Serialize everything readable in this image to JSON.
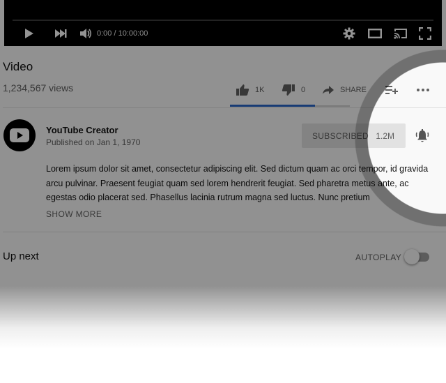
{
  "player": {
    "time_display": "0:00 / 10:00:00"
  },
  "video": {
    "title": "Video",
    "views": "1,234,567 views",
    "actions": {
      "like_count": "1K",
      "dislike_count": "0",
      "share_label": "SHARE"
    }
  },
  "channel": {
    "name": "YouTube Creator",
    "published": "Published on Jan 1, 1970",
    "subscribe_label": "SUBSCRIBED",
    "subscriber_count": "1.2M"
  },
  "description": {
    "text": "Lorem ipsum dolor sit amet, consectetur adipiscing elit. Sed dictum quam ac orci tempor, id gravida arcu pulvinar. Praesent feugiat quam sed lorem hendrerit feugiat. Sed pharetra metus ante, ac egestas odio placerat sed. Phasellus lacinia rutrum magna sed luctus. Nunc pretium",
    "show_more_label": "SHOW MORE"
  },
  "up_next": {
    "title": "Up next",
    "autoplay_label": "AUTOPLAY",
    "autoplay_on": false
  },
  "icons": {
    "play": "play-icon",
    "next": "skip-next-icon",
    "volume": "volume-icon",
    "settings": "gear-icon",
    "theater": "theater-mode-icon",
    "cast": "cast-icon",
    "fullscreen": "fullscreen-icon",
    "like": "thumbs-up-icon",
    "dislike": "thumbs-down-icon",
    "share": "share-arrow-icon",
    "add_to": "add-to-playlist-icon",
    "more": "more-dots-icon",
    "bell": "bell-icon"
  },
  "colors": {
    "accent_blue": "#2a65c8",
    "player_bg": "#000000"
  }
}
